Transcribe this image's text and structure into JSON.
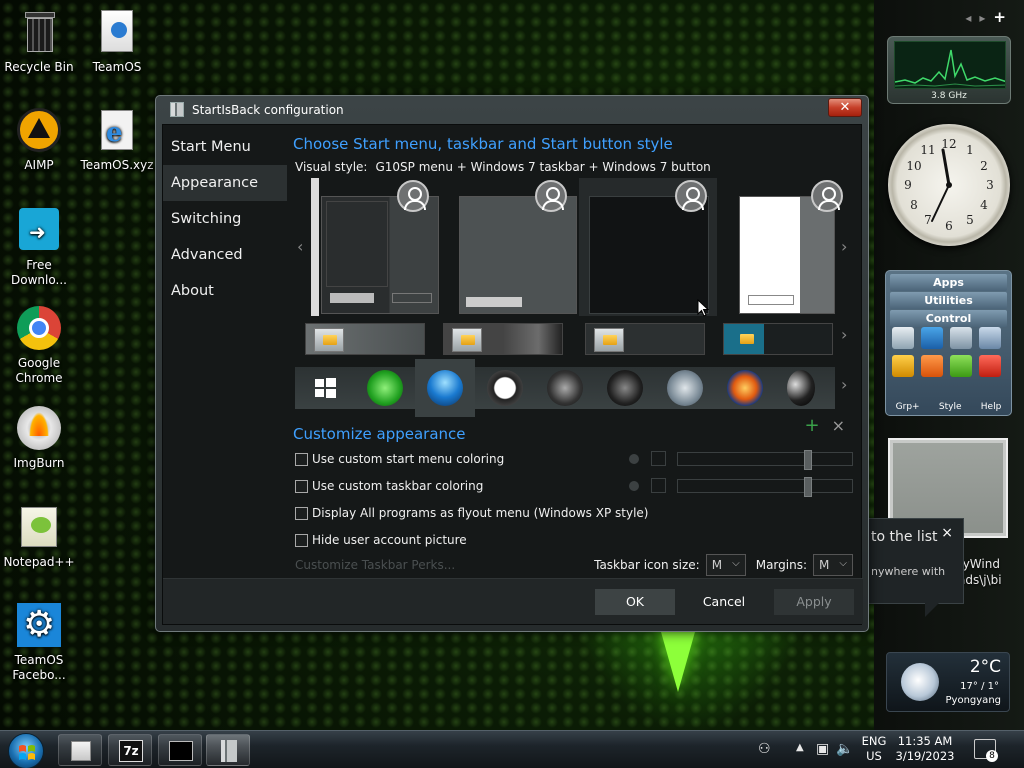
{
  "desktop": {
    "icons": [
      {
        "label": "Recycle Bin"
      },
      {
        "label": "TeamOS"
      },
      {
        "label": "AIMP"
      },
      {
        "label": "TeamOS.xyz"
      },
      {
        "label": "Free Downlo..."
      },
      {
        "label": "Google Chrome"
      },
      {
        "label": "ImgBurn"
      },
      {
        "label": "Notepad++"
      },
      {
        "label": "TeamOS Facebo..."
      }
    ],
    "behind_window_text": [
      "tyWind",
      "ads\\j\\bi"
    ]
  },
  "gadgets": {
    "cpu_label": "3.8 GHz",
    "clock_numbers": [
      "12",
      "1",
      "2",
      "3",
      "4",
      "5",
      "6",
      "7",
      "8",
      "9",
      "10",
      "11"
    ],
    "launcher": {
      "menu": [
        "Apps",
        "Utilities",
        "Control"
      ],
      "footer": [
        "Grp+",
        "Style",
        "Help"
      ]
    },
    "weather": {
      "temp": "2°C",
      "range": "17° / 1°",
      "city": "Pyongyang"
    }
  },
  "tooltip": {
    "title": "to the list",
    "body": "nywhere with",
    "close": "×"
  },
  "dialog": {
    "title": "StartIsBack configuration",
    "close": "✕",
    "nav": [
      "Start Menu",
      "Appearance",
      "Switching",
      "Advanced",
      "About"
    ],
    "active_nav": "Appearance",
    "section1_title": "Choose Start menu, taskbar and Start button style",
    "visual_style_label": "Visual style:",
    "visual_style_value": "G10SP menu + Windows 7 taskbar + Windows 7 button",
    "section2_title": "Customize appearance",
    "checkboxes": [
      {
        "label": "Use custom start menu coloring",
        "checked": false
      },
      {
        "label": "Use custom taskbar coloring",
        "checked": false
      },
      {
        "label": "Display All programs as flyout menu (Windows XP style)",
        "checked": false
      },
      {
        "label": "Hide user account picture",
        "checked": false
      }
    ],
    "customize_link": "Customize Taskbar Perks...",
    "taskbar_icon_size_label": "Taskbar icon size:",
    "taskbar_icon_size_value": "M",
    "margins_label": "Margins:",
    "margins_value": "M",
    "buttons": {
      "ok": "OK",
      "cancel": "Cancel",
      "apply": "Apply"
    }
  },
  "taskbar": {
    "lang_top": "ENG",
    "lang_bottom": "US",
    "time": "11:35 AM",
    "date": "3/19/2023",
    "notifications": "8",
    "sevenzip_label": "7z"
  },
  "colors": {
    "accent": "#3fa0ff",
    "dialog_bg": "#151818"
  }
}
